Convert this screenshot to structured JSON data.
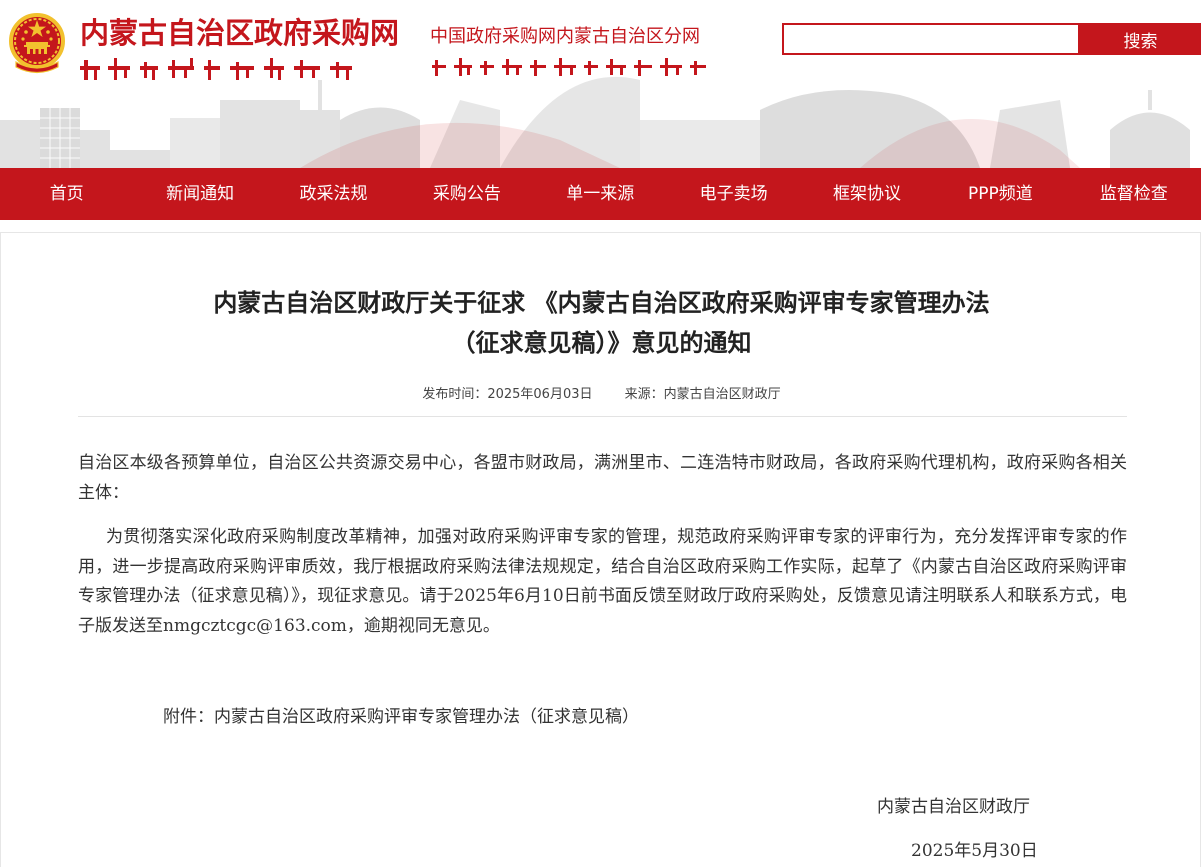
{
  "header": {
    "site_title": "内蒙古自治区政府采购网",
    "site_subtitle": "中国政府采购网内蒙古自治区分网",
    "search_placeholder": "",
    "search_button": "搜索",
    "colors": {
      "brand_red": "#c4161c",
      "emblem_gold": "#f2c12e"
    }
  },
  "nav": {
    "items": [
      "首页",
      "新闻通知",
      "政采法规",
      "采购公告",
      "单一来源",
      "电子卖场",
      "框架协议",
      "PPP频道",
      "监督检查"
    ]
  },
  "article": {
    "title_line1": "内蒙古自治区财政厅关于征求 《内蒙古自治区政府采购评审专家管理办法",
    "title_line2": "（征求意见稿）》意见的通知",
    "publish_time": "发布时间：2025年06月03日",
    "source": "来源：内蒙古自治区财政厅",
    "paragraph1": "自治区本级各预算单位，自治区公共资源交易中心，各盟市财政局，满洲里市、二连浩特市财政局，各政府采购代理机构，政府采购各相关主体：",
    "paragraph2": "为贯彻落实深化政府采购制度改革精神，加强对政府采购评审专家的管理，规范政府采购评审专家的评审行为，充分发挥评审专家的作用，进一步提高政府采购评审质效，我厅根据政府采购法律法规规定，结合自治区政府采购工作实际，起草了《内蒙古自治区政府采购评审专家管理办法（征求意见稿）》，现征求意见。请于2025年6月10日前书面反馈至财政厅政府采购处，反馈意见请注明联系人和联系方式，电子版发送至nmgcztcgc@163.com，逾期视同无意见。",
    "attachment": "附件：内蒙古自治区政府采购评审专家管理办法（征求意见稿）",
    "signature_org": "内蒙古自治区财政厅",
    "signature_date": "2025年5月30日"
  }
}
